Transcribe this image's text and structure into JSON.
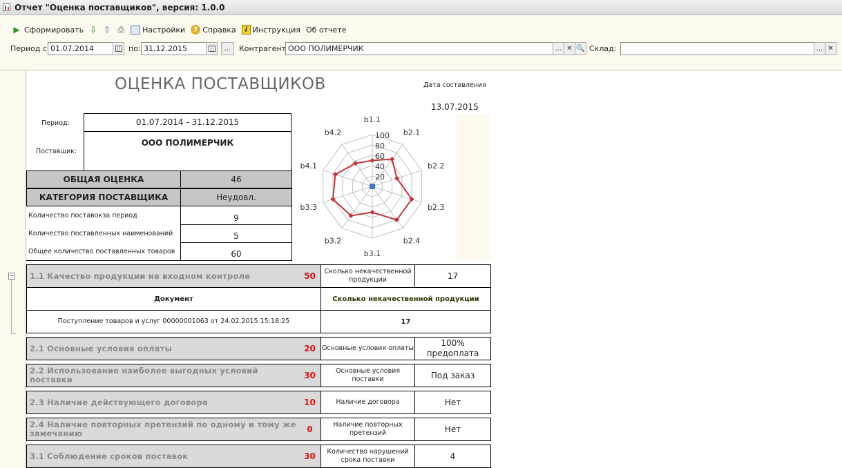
{
  "window": {
    "title": "Отчет  \"Оценка поставщиков\", версия: 1.0.0"
  },
  "toolbar": {
    "generate": "Сформировать",
    "settings": "Настройки",
    "help": "Справка",
    "instruction": "Инструкция",
    "about": "Об отчете"
  },
  "filters": {
    "period_from_label": "Период с:",
    "period_from": "01.07.2014",
    "period_to_label": "по:",
    "period_to": "31.12.2015",
    "counterparty_label": "Контрагент:",
    "counterparty": "ООО ПОЛИМЕРЧИК",
    "warehouse_label": "Склад:",
    "warehouse": ""
  },
  "report": {
    "title": "ОЦЕНКА ПОСТАВЩИКОВ",
    "date_label": "Дата составления",
    "date": "13.07.2015",
    "period_label": "Период:",
    "period": "01.07.2014 - 31.12.2015",
    "supplier_label": "Поставщик:",
    "supplier": "ООО ПОЛИМЕРЧИК",
    "total_label": "ОБЩАЯ ОЦЕНКА",
    "total": "46",
    "category_label": "КАТЕГОРИЯ ПОСТАВЩИКА",
    "category": "Неудовл.",
    "stats": [
      {
        "label": "Количество поставокза период",
        "value": "9"
      },
      {
        "label": "Количество поставленных наименований",
        "value": "5"
      },
      {
        "label": "Общее количество поставленных товаров",
        "value": "60"
      }
    ],
    "quality": {
      "name": "1.1 Качество продукции на входном контроле",
      "score": "50",
      "param": "Сколько некачественной продукции",
      "value": "17",
      "doc_header": "Документ",
      "qty_header": "Сколько некачественной продукции",
      "doc": "Поступление товаров и услуг 00000001063 от 24.02.2015 15:18:25",
      "doc_qty": "17"
    },
    "criteria": [
      {
        "name": "2.1 Основные условия оплаты",
        "score": "20",
        "param": "Основные условия оплаты",
        "value": "100% предоплата"
      },
      {
        "name": "2.2 Использование наиболее выгодных условий поставки",
        "score": "30",
        "param": "Основные условия поставки",
        "value": "Под заказ"
      },
      {
        "name": "2.3 Наличие действующего договора",
        "score": "10",
        "param": "Наличие договора",
        "value": "Нет"
      },
      {
        "name": "2.4 Наличие повторных претензий по одному и тому же замечанию",
        "score": "0",
        "param": "Наличие повторных претензий",
        "value": "Нет"
      },
      {
        "name": "3.1 Соблюдение сроков поставок",
        "score": "30",
        "param": "Количество нарушений срока поставки",
        "value": "4"
      }
    ]
  },
  "chart_data": {
    "type": "radar",
    "categories": [
      "b1.1",
      "b2.1",
      "b2.2",
      "b2.3",
      "b2.4",
      "b3.1",
      "b3.2",
      "b3.3",
      "b4.1",
      "b4.2"
    ],
    "series": [
      {
        "values": [
          50,
          65,
          50,
          80,
          80,
          50,
          70,
          80,
          75,
          55
        ]
      },
      {
        "values": [
          0,
          0,
          0,
          0,
          0,
          0,
          0,
          0,
          0,
          0
        ]
      }
    ],
    "radial_ticks": [
      "20",
      "40",
      "60",
      "80",
      "100"
    ],
    "rlim": [
      0,
      100
    ],
    "colors": {
      "main": "#c0353a",
      "zero": "#4a78c8",
      "grid": "#c0c0c0"
    }
  }
}
